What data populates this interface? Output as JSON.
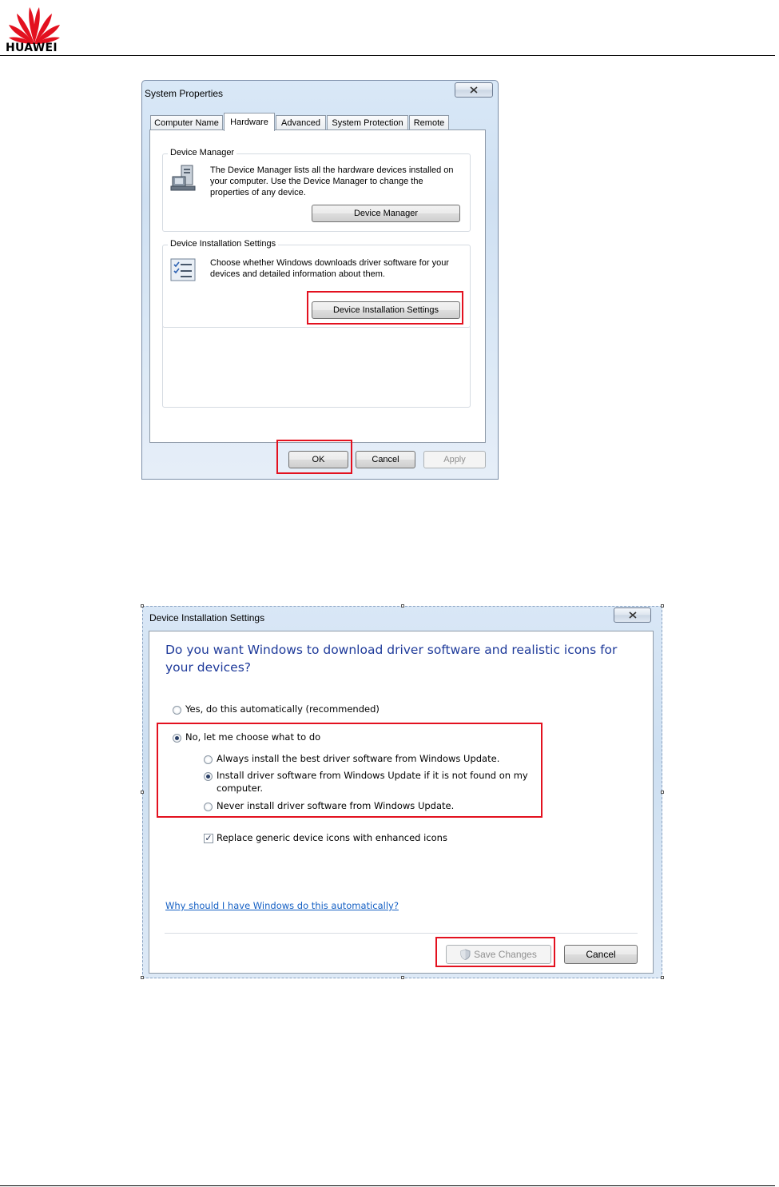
{
  "header": {
    "brand": "HUAWEI",
    "brand_color": "#e3111f"
  },
  "system_properties": {
    "title": "System Properties",
    "close_icon": "x",
    "tabs": [
      {
        "label": "Computer Name",
        "active": false
      },
      {
        "label": "Hardware",
        "active": true
      },
      {
        "label": "Advanced",
        "active": false
      },
      {
        "label": "System Protection",
        "active": false
      },
      {
        "label": "Remote",
        "active": false
      }
    ],
    "device_manager": {
      "group_label": "Device Manager",
      "description": "The Device Manager lists all the hardware devices installed on your computer. Use the Device Manager to change the properties of any device.",
      "button": "Device Manager",
      "icon": "device-manager-icon"
    },
    "device_installation": {
      "group_label": "Device Installation Settings",
      "description": "Choose whether Windows downloads driver software for your devices and detailed information about them.",
      "button": "Device Installation Settings",
      "icon": "checklist-icon"
    },
    "footer": {
      "ok": "OK",
      "cancel": "Cancel",
      "apply": "Apply"
    }
  },
  "device_installation_settings": {
    "title": "Device Installation Settings",
    "close_icon": "x",
    "question": "Do you want Windows to download driver software and realistic icons for your devices?",
    "options": {
      "yes": {
        "label": "Yes, do this automatically (recommended)",
        "selected": false
      },
      "no": {
        "label": "No, let me choose what to do",
        "selected": true
      }
    },
    "sub_options": [
      {
        "label": "Always install the best driver software from Windows Update.",
        "selected": false
      },
      {
        "label": "Install driver software from Windows Update if it is not found on my computer.",
        "selected": true
      },
      {
        "label": "Never install driver software from Windows Update.",
        "selected": false
      }
    ],
    "replace_icons": {
      "label": "Replace generic device icons with enhanced icons",
      "checked": true
    },
    "link": "Why should I have Windows do this automatically?",
    "save_button": "Save Changes",
    "save_icon": "uac-shield-icon",
    "cancel_button": "Cancel"
  }
}
